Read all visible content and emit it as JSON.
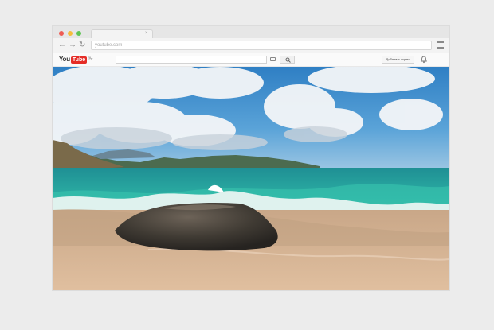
{
  "browser": {
    "url": "youtube.com",
    "tab_close": "×",
    "nav": {
      "back": "←",
      "forward": "→",
      "reload": "↻"
    }
  },
  "youtube": {
    "logo_you": "You",
    "logo_tube": "Tube",
    "logo_region": "RU",
    "upload_button": "Добавить видео"
  },
  "colors": {
    "brand_red": "#e52d27",
    "sky": "#3a88c7",
    "sea": "#2aa89a",
    "sand": "#d9b594"
  },
  "video": {
    "scene": "beach-video-frame"
  }
}
